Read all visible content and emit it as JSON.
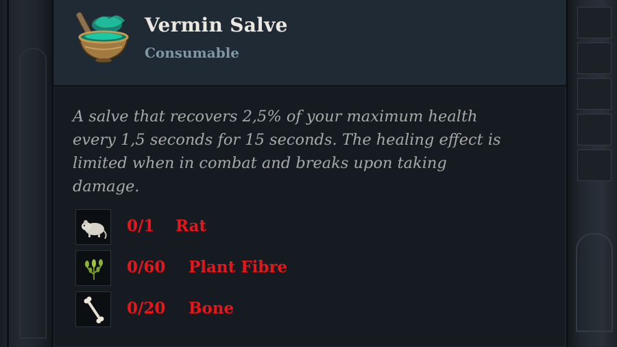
{
  "item": {
    "name": "Vermin Salve",
    "type": "Consumable",
    "icon": "mortar-pestle-icon",
    "description": "A salve that recovers 2,5% of your maximum health every 1,5 seconds for 15 seconds. The healing effect is limited when in combat and breaks upon taking damage."
  },
  "requirements": [
    {
      "count": "0/1",
      "name": "Rat",
      "icon": "rat-icon"
    },
    {
      "count": "0/60",
      "name": "Plant Fibre",
      "icon": "plant-fibre-icon"
    },
    {
      "count": "0/20",
      "name": "Bone",
      "icon": "bone-icon"
    }
  ],
  "colors": {
    "title": "#ece8df",
    "type": "#7d97a5",
    "description": "#a8a9a7",
    "missing": "#e8161a",
    "header_bg": "#1f2a34",
    "panel_bg": "#161b21"
  }
}
